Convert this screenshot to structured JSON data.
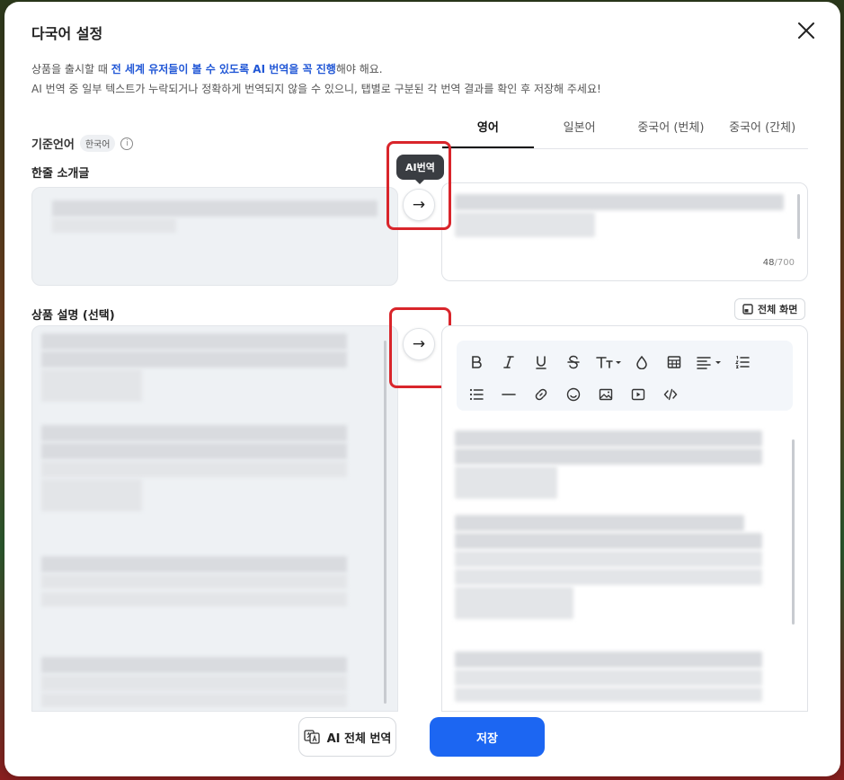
{
  "modal": {
    "title": "다국어 설정",
    "notice_line1_a": "상품을 출시할 때 ",
    "notice_line1_b": "전 세계 유저들이 볼 수 있도록 AI 번역을 꼭 진행",
    "notice_line1_c": "해야 해요.",
    "notice_line2": "AI 번역 중 일부 텍스트가 누락되거나 정확하게 번역되지 않을 수 있으니, 탭별로 구분된 각 번역 결과를 확인 후 저장해 주세요!"
  },
  "base_language": {
    "label": "기준언어",
    "badge": "한국어",
    "info_glyph": "i"
  },
  "tabs": [
    {
      "label": "영어",
      "active": true
    },
    {
      "label": "일본어",
      "active": false
    },
    {
      "label": "중국어 (번체)",
      "active": false
    },
    {
      "label": "중국어 (간체)",
      "active": false
    }
  ],
  "sections": {
    "intro_label": "한줄 소개글",
    "description_label": "상품 설명 (선택)"
  },
  "translate": {
    "tooltip": "AI번역",
    "arrow_glyph": "→"
  },
  "intro_counter": {
    "current": "48",
    "max": "/700"
  },
  "fullscreen": {
    "label": "전체 화면"
  },
  "footer": {
    "translate_all_label": "AI 전체 번역",
    "save_label": "저장"
  },
  "colors": {
    "primary": "#1c66f2",
    "highlight": "#2157d6",
    "annotation": "#d9252b"
  }
}
